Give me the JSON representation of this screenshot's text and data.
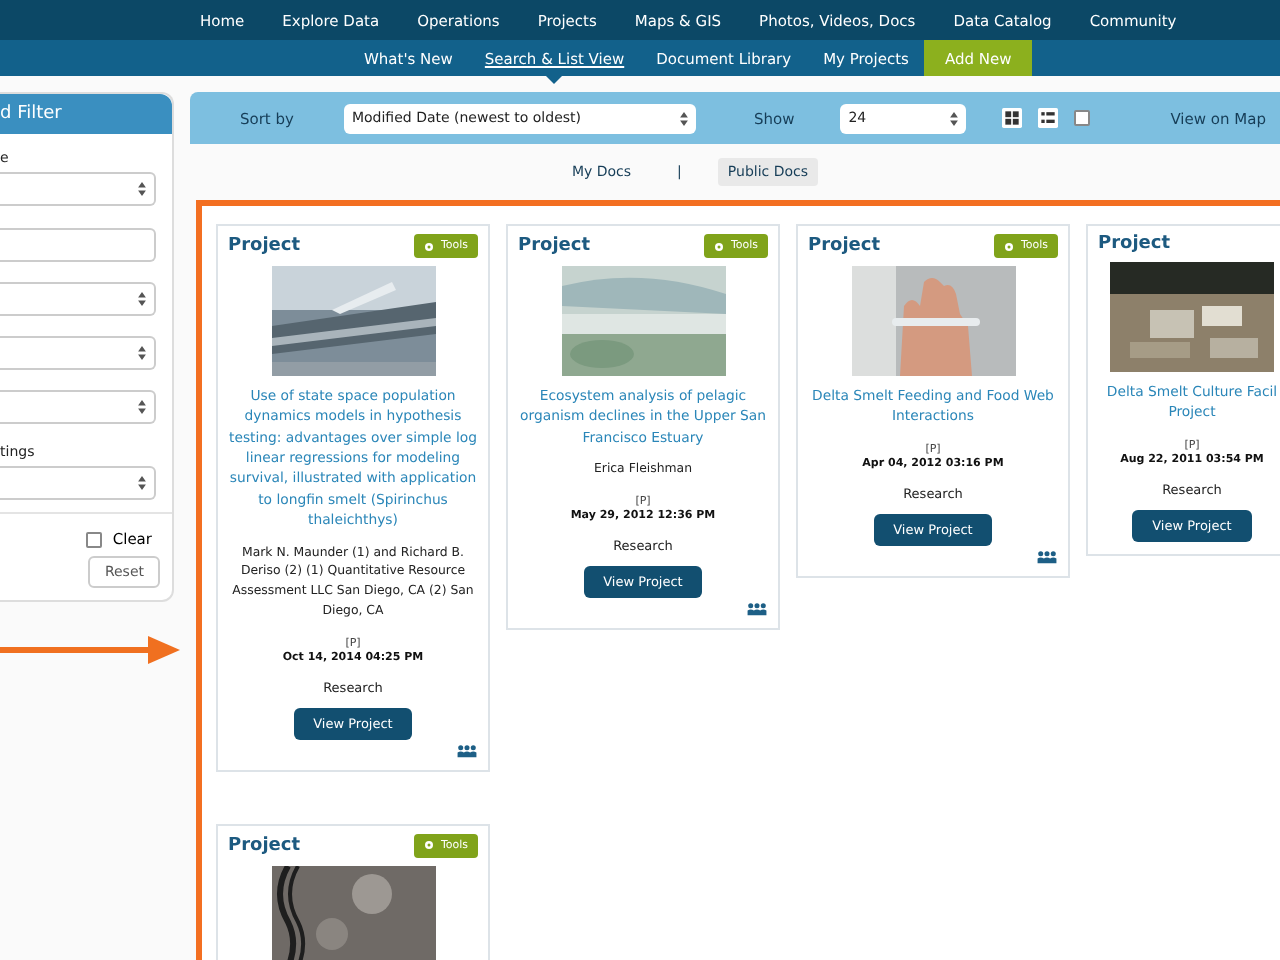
{
  "nav": {
    "items": [
      "Home",
      "Explore Data",
      "Operations",
      "Projects",
      "Maps & GIS",
      "Photos, Videos, Docs",
      "Data Catalog",
      "Community"
    ]
  },
  "subnav": {
    "items": [
      {
        "label": "What's New",
        "selected": false,
        "kind": "link"
      },
      {
        "label": "Search & List View",
        "selected": true,
        "kind": "link"
      },
      {
        "label": "Document Library",
        "selected": false,
        "kind": "link"
      },
      {
        "label": "My Projects",
        "selected": false,
        "kind": "link"
      },
      {
        "label": "Add New",
        "selected": false,
        "kind": "action"
      }
    ]
  },
  "sidebar": {
    "title": "d Filter",
    "fields": [
      {
        "kind": "select",
        "label": "e"
      },
      {
        "kind": "input"
      },
      {
        "kind": "select"
      },
      {
        "kind": "select"
      },
      {
        "kind": "select"
      },
      {
        "kind": "select",
        "label": "tings"
      }
    ],
    "clear": {
      "label": "Clear",
      "checked": false
    },
    "reset": "Reset"
  },
  "toolbar": {
    "sort_label": "Sort by",
    "sort_value": "Modified Date (newest to oldest)",
    "show_label": "Show",
    "show_value": "24",
    "map_checkbox": {
      "checked": false
    },
    "view_on_map": "View on Map"
  },
  "doc_tabs": [
    {
      "label": "My Docs",
      "selected": false
    },
    {
      "label": "Public Docs",
      "selected": true
    }
  ],
  "doc_tabs_separator": "|",
  "cards": [
    {
      "heading": "Project",
      "tools": "Tools",
      "title": "Use of state space population dynamics models in hypothesis testing: advantages over simple log linear regressions for modeling survival, illustrated with application to longfin smelt (Spirinchus thaleichthys)",
      "author": "Mark N. Maunder (1) and Richard B. Deriso (2) (1) Quantitative Resource Assessment LLC San Diego, CA (2) San Diego, CA",
      "tag": "[P]",
      "date": "Oct 14, 2014 04:25 PM",
      "category": "Research",
      "button": "View Project",
      "team": true
    },
    {
      "heading": "Project",
      "tools": "Tools",
      "title": "Ecosystem analysis of pelagic organism declines in the Upper San Francisco Estuary",
      "author": "Erica Fleishman",
      "tag": "[P]",
      "date": "May 29, 2012 12:36 PM",
      "category": "Research",
      "button": "View Project",
      "team": true
    },
    {
      "heading": "Project",
      "tools": "Tools",
      "title": "Delta Smelt Feeding and Food Web Interactions",
      "tag": "[P]",
      "date": "Apr 04, 2012 03:16 PM",
      "category": "Research",
      "button": "View Project",
      "team": true
    },
    {
      "heading": "Project",
      "title": "Delta Smelt Culture Facil Project",
      "tag": "[P]",
      "date": "Aug 22, 2011 03:54 PM",
      "category": "Research",
      "button": "View Project",
      "team": false
    },
    {
      "heading": "Project",
      "tools": "Tools",
      "team": false
    }
  ]
}
